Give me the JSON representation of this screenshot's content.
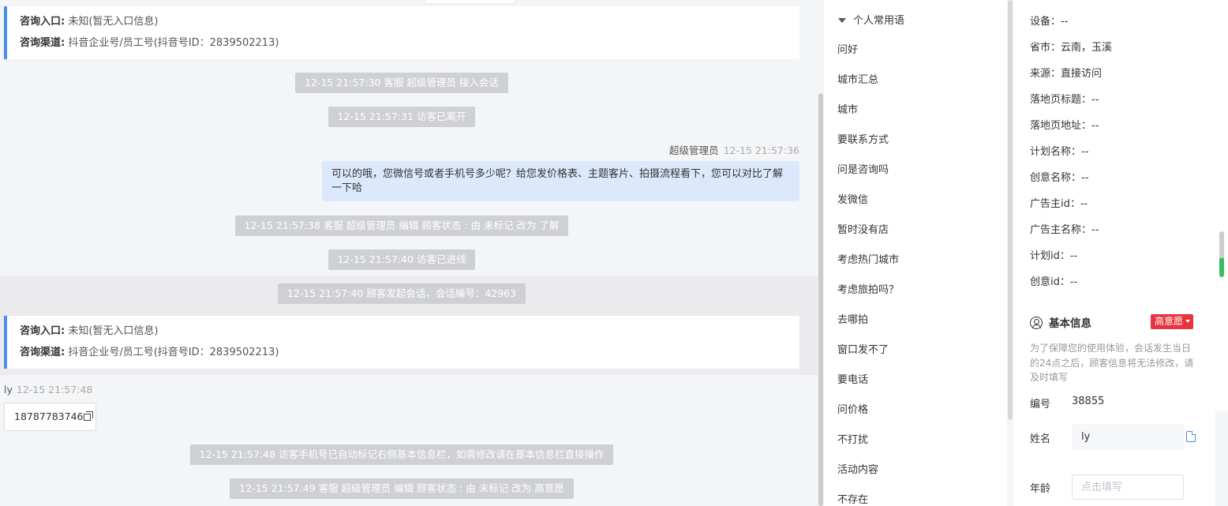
{
  "chat": {
    "entry_label": "咨询入口:",
    "entry_value": "未知(暂无入口信息)",
    "channel_label": "咨询渠道:",
    "channel_value": "抖音企业号/员工号(抖音号ID：2839502213)",
    "events": [
      "12-15 21:57:30 客服 超级管理员 接入会话",
      "12-15 21:57:31 访客已离开",
      "12-15 21:57:38 客服 超级管理员 编辑 顾客状态 : 由 未标记 改为 了解",
      "12-15 21:57:40 访客已进线",
      "12-15 21:57:40 顾客发起会话，会话编号：42963",
      "12-15 21:57:48 访客手机号已自动标记右侧基本信息栏，如需修改请在基本信息栏直接操作",
      "12-15 21:57:49 客服 超级管理员 编辑 顾客状态 : 由 未标记 改为 高意愿"
    ],
    "agent_message": {
      "sender": "超级管理员",
      "time": "12-15 21:57:36",
      "text": "可以的哦，您微信号或者手机号多少呢？给您发价格表、主题客片、拍摄流程看下，您可以对比了解一下哈"
    },
    "visitor_message": {
      "sender": "ly",
      "time": "12-15 21:57:48",
      "text": "18787783746"
    }
  },
  "phrases": {
    "header": "个人常用语",
    "items": [
      "问好",
      "城市汇总",
      "城市",
      "要联系方式",
      "问是咨询吗",
      "发微信",
      "暂时没有店",
      "考虑热门城市",
      "考虑旅拍吗？",
      "去哪拍",
      "窗口发不了",
      "要电话",
      "问价格",
      "不打扰",
      "活动内容",
      "不存在"
    ]
  },
  "visitor_info": {
    "fields": [
      "设备：--",
      "省市：云南，玉溪",
      "来源：直接访问",
      "落地页标题：--",
      "落地页地址：--",
      "计划名称：--",
      "创意名称：--",
      "广告主id：--",
      "广告主名称：--",
      "计划id：--",
      "创意id：--"
    ],
    "basic_title": "基本信息",
    "intent_badge": "高意愿",
    "notice": "为了保障您的使用体验，会话发生当日的24点之后，顾客信息将无法修改，请及时填写",
    "id_label": "编号",
    "id_value": "38855",
    "name_label": "姓名",
    "name_value": "ly",
    "age_label": "年龄",
    "age_placeholder": "点击填写"
  },
  "colors": {
    "accent_blue": "#4a8ee8",
    "agent_bubble": "#dce9fc",
    "system_tag": "#cfd0d3",
    "intent_red": "#e7343f",
    "scroll_green": "#3dbb5f"
  }
}
